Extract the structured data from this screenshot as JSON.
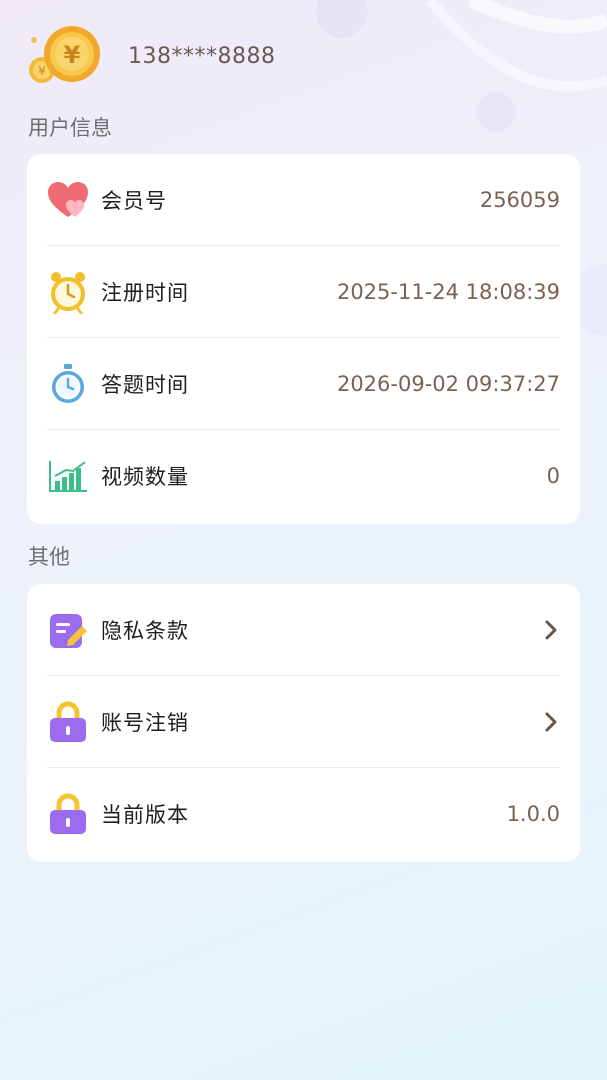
{
  "user": {
    "phone": "138****8888",
    "avatar_icon": "gold-yuan-coin-icon"
  },
  "sections": {
    "user_info": {
      "title": "用户信息",
      "rows": [
        {
          "label": "会员号",
          "value": "256059",
          "icon": "heart-icon"
        },
        {
          "label": "注册时间",
          "value": "2025-11-24 18:08:39",
          "icon": "alarm-clock-icon"
        },
        {
          "label": "答题时间",
          "value": "2026-09-02 09:37:27",
          "icon": "stopwatch-icon"
        },
        {
          "label": "视频数量",
          "value": "0",
          "icon": "bar-chart-icon"
        }
      ]
    },
    "other": {
      "title": "其他",
      "rows": [
        {
          "label": "隐私条款",
          "icon": "document-edit-icon",
          "action": "chevron-right-icon"
        },
        {
          "label": "账号注销",
          "icon": "lock-icon",
          "action": "chevron-right-icon"
        },
        {
          "label": "当前版本",
          "value": "1.0.0",
          "icon": "lock-icon"
        }
      ]
    }
  },
  "colors": {
    "value_text": "#7a6253",
    "heart": "#f06a74",
    "clock": "#f2c029",
    "stopwatch": "#5aa8e0",
    "chart": "#3bbf8a",
    "purple": "#9b6cf0"
  }
}
